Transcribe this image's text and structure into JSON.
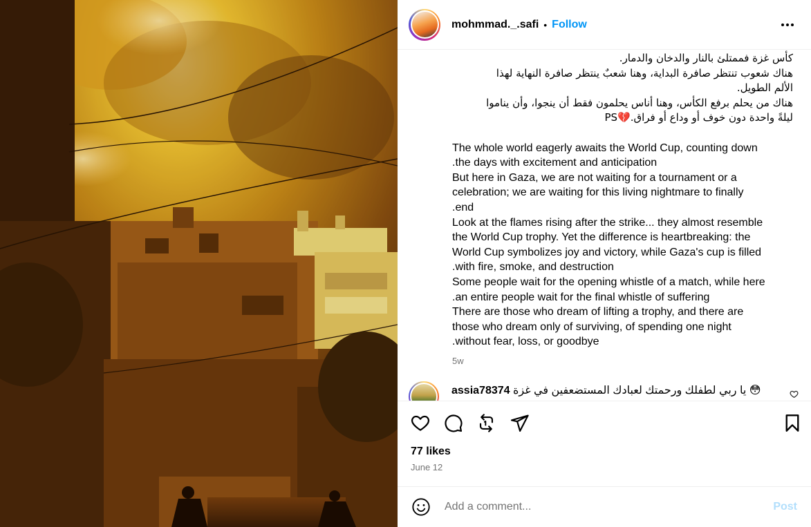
{
  "author": {
    "username": "mohmmad._.safi",
    "separator": "•",
    "follow_label": "Follow"
  },
  "caption": {
    "arabic_lines": [
      "كأس غزة فممتلئ بالنار والدخان والدمار.",
      "هناك شعوب تنتظر صافرة البداية، وهنا شعبٌ ينتظر صافرة النهاية لهذا",
      "الألم الطويل.",
      "هناك من يحلم برفع الكأس، وهنا أناس يحلمون فقط أن ينجوا، وأن يناموا",
      "ليلةً واحدة دون خوف أو وداع أو فراق.💔PS"
    ],
    "english_lines": [
      "The whole world eagerly awaits the World Cup, counting down",
      ".the days with excitement and anticipation",
      "But here in Gaza, we are not waiting for a tournament or a",
      "celebration; we are waiting for this living nightmare to finally",
      ".end",
      "Look at the flames rising after the strike... they almost resemble",
      "the World Cup trophy. Yet the difference is heartbreaking: the",
      "World Cup symbolizes joy and victory, while Gaza's cup is filled",
      ".with fire, smoke, and destruction",
      "Some people wait for the opening whistle of a match, while here",
      ".an entire people wait for the final whistle of suffering",
      "There are those who dream of lifting a trophy, and there are",
      "those who dream only of surviving, of spending one night",
      ".without fear, loss, or goodbye"
    ],
    "time_ago": "5w"
  },
  "comment": {
    "username": "assia78374",
    "text": "يا ربي لطفلك ورحمتك لعبادك المستضعفين في غزة 😳"
  },
  "actions": {
    "icons": [
      "heart-icon",
      "comment-icon",
      "repost-icon",
      "share-icon",
      "bookmark-icon"
    ]
  },
  "stats": {
    "likes": "77 likes",
    "date": "June 12"
  },
  "add_comment": {
    "placeholder": "Add a comment...",
    "post_label": "Post"
  },
  "colors": {
    "accent": "#0095f6",
    "post_disabled": "#b2dffc",
    "muted": "#737373"
  }
}
